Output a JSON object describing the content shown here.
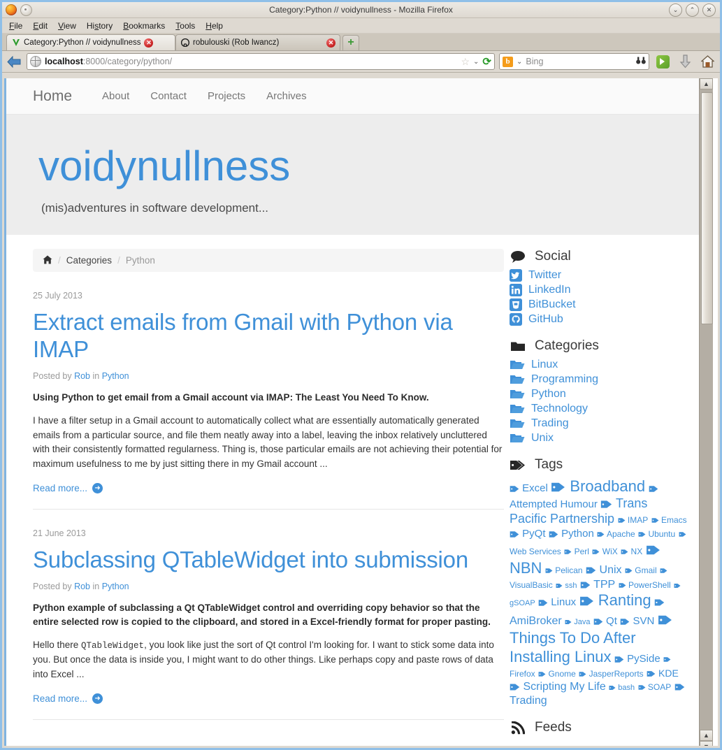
{
  "window": {
    "title": "Category:Python // voidynullness - Mozilla Firefox",
    "buttons": {
      "minimize": "⌄",
      "maximize": "⌃",
      "close": "✕"
    }
  },
  "menubar": [
    {
      "label": "File",
      "accel": "F"
    },
    {
      "label": "Edit",
      "accel": "E"
    },
    {
      "label": "View",
      "accel": "V"
    },
    {
      "label": "History",
      "accel": "s"
    },
    {
      "label": "Bookmarks",
      "accel": "B"
    },
    {
      "label": "Tools",
      "accel": "T"
    },
    {
      "label": "Help",
      "accel": "H"
    }
  ],
  "tabs": [
    {
      "label": "Category:Python // voidynullness",
      "favicon": "V",
      "active": true,
      "close": "✕"
    },
    {
      "label": "robulouski (Rob Iwancz)",
      "favicon": "github-mark",
      "active": false,
      "close": "✕"
    }
  ],
  "newtab_label": "+",
  "toolbar": {
    "back_icon": "←",
    "url_host": "localhost",
    "url_rest": ":8000/category/python/",
    "star_icon": "☆",
    "dropdown_icon": "⌄",
    "reload_icon": "⟳",
    "search_engine": "Bing",
    "search_engine_letter": "b",
    "search_placeholder": "Bing",
    "binoculars_icon": "⌗",
    "feedly_icon": "feedly-icon",
    "download_icon": "⇓",
    "home_icon": "⌂"
  },
  "site": {
    "nav": [
      {
        "label": "Home",
        "brand": true
      },
      {
        "label": "About",
        "brand": false
      },
      {
        "label": "Contact",
        "brand": false
      },
      {
        "label": "Projects",
        "brand": false
      },
      {
        "label": "Archives",
        "brand": false
      }
    ],
    "hero_title": "voidynullness",
    "hero_tagline": "(mis)adventures in software development..."
  },
  "breadcrumb": {
    "home_icon": "⌂",
    "sep": "/",
    "items": [
      {
        "label": "Categories",
        "current": false
      },
      {
        "label": "Python",
        "current": true
      }
    ]
  },
  "articles": [
    {
      "date": "25 July 2013",
      "title": "Extract emails from Gmail with Python via IMAP",
      "posted_by_prefix": "Posted by ",
      "author": "Rob",
      "in_word": " in ",
      "category": "Python",
      "lede": "Using Python to get email from a Gmail account via IMAP: The Least You Need To Know.",
      "body": "I have a filter setup in a Gmail account to automatically collect what are essentially automatically generated emails from a particular source, and file them neatly away into a label, leaving the inbox relatively uncluttered with their consistently formatted regularness. Thing is, those particular emails are not achieving their potential for maximum usefulness to me by just sitting there in my Gmail account ...",
      "read_more": "Read more...",
      "read_more_icon": "➜"
    },
    {
      "date": "21 June 2013",
      "title": "Subclassing QTableWidget into submission",
      "posted_by_prefix": "Posted by ",
      "author": "Rob",
      "in_word": " in ",
      "category": "Python",
      "lede": "Python example of subclassing a Qt QTableWidget control and overriding copy behavior so that the entire selected row is copied to the clipboard, and stored in a Excel-friendly format for proper pasting.",
      "body_pre": "Hello there ",
      "body_code": "QTableWidget",
      "body_post": ", you look like just the sort of Qt control I'm looking for. I want to stick some data into you. But once the data is inside you, I might want to do other things. Like perhaps copy and paste rows of data into Excel ...",
      "read_more": "Read more...",
      "read_more_icon": "➜"
    }
  ],
  "sidebar": {
    "social": {
      "heading": "Social",
      "icon": "speech-bubble-icon",
      "items": [
        {
          "label": "Twitter",
          "icon": "twitter-icon",
          "glyph": "ᴠ"
        },
        {
          "label": "LinkedIn",
          "icon": "linkedin-icon",
          "glyph": "in"
        },
        {
          "label": "BitBucket",
          "icon": "bitbucket-icon",
          "glyph": "□"
        },
        {
          "label": "GitHub",
          "icon": "github-icon",
          "glyph": "●"
        }
      ]
    },
    "categories": {
      "heading": "Categories",
      "icon": "folder-icon",
      "items": [
        {
          "label": "Linux"
        },
        {
          "label": "Programming"
        },
        {
          "label": "Python"
        },
        {
          "label": "Technology"
        },
        {
          "label": "Trading"
        },
        {
          "label": "Unix"
        }
      ]
    },
    "tags": {
      "heading": "Tags",
      "icon": "tags-icon",
      "items": [
        {
          "label": "Excel",
          "size": 15
        },
        {
          "label": "Broadband",
          "size": 22
        },
        {
          "label": "Attempted Humour",
          "size": 15
        },
        {
          "label": "Trans Pacific Partnership",
          "size": 18
        },
        {
          "label": "IMAP",
          "size": 12
        },
        {
          "label": "Emacs",
          "size": 12
        },
        {
          "label": "PyQt",
          "size": 15
        },
        {
          "label": "Python",
          "size": 15
        },
        {
          "label": "Apache",
          "size": 12
        },
        {
          "label": "Ubuntu",
          "size": 12
        },
        {
          "label": "Web Services",
          "size": 12
        },
        {
          "label": "Perl",
          "size": 12
        },
        {
          "label": "WiX",
          "size": 12
        },
        {
          "label": "NX",
          "size": 12
        },
        {
          "label": "NBN",
          "size": 22
        },
        {
          "label": "Pelican",
          "size": 12
        },
        {
          "label": "Unix",
          "size": 16
        },
        {
          "label": "Gmail",
          "size": 12
        },
        {
          "label": "VisualBasic",
          "size": 12
        },
        {
          "label": "ssh",
          "size": 11
        },
        {
          "label": "TPP",
          "size": 16
        },
        {
          "label": "PowerShell",
          "size": 12
        },
        {
          "label": "gSOAP",
          "size": 11
        },
        {
          "label": "Linux",
          "size": 15
        },
        {
          "label": "Ranting",
          "size": 22
        },
        {
          "label": "AmiBroker",
          "size": 16
        },
        {
          "label": "Java",
          "size": 11
        },
        {
          "label": "Qt",
          "size": 15
        },
        {
          "label": "SVN",
          "size": 15
        },
        {
          "label": "Things To Do After Installing Linux",
          "size": 22
        },
        {
          "label": "PySide",
          "size": 15
        },
        {
          "label": "Firefox",
          "size": 12
        },
        {
          "label": "Gnome",
          "size": 12
        },
        {
          "label": "JasperReports",
          "size": 12
        },
        {
          "label": "KDE",
          "size": 14
        },
        {
          "label": "Scripting My Life",
          "size": 16
        },
        {
          "label": "bash",
          "size": 11
        },
        {
          "label": "SOAP",
          "size": 12
        },
        {
          "label": "Trading",
          "size": 16
        }
      ]
    },
    "feeds": {
      "heading": "Feeds",
      "icon": "rss-icon"
    }
  },
  "colors": {
    "link_blue": "#3f90d8",
    "hero_bg": "#ededed",
    "muted_text": "#9a9a9a",
    "chrome_bg": "#ded9d1",
    "window_border": "#8fbfe8"
  }
}
